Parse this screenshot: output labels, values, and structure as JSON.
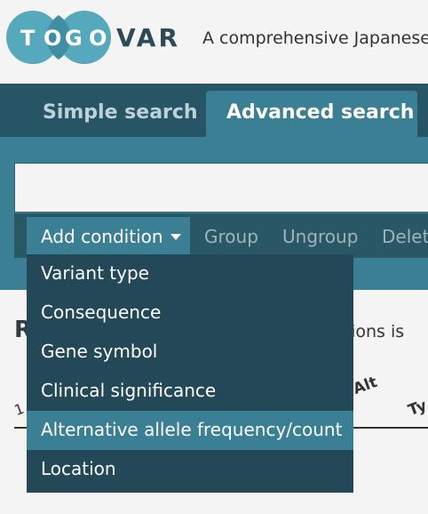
{
  "header": {
    "logo_letters": [
      "T",
      "O",
      "G",
      "O"
    ],
    "logo_suffix": "VAR",
    "tagline": "A comprehensive Japanese"
  },
  "nav": {
    "tabs": [
      {
        "label": "Simple search",
        "active": false
      },
      {
        "label": "Advanced search",
        "active": true
      }
    ]
  },
  "search": {
    "value": ""
  },
  "toolbar": {
    "add_condition": "Add condition",
    "group": "Group",
    "ungroup": "Ungroup",
    "delete": "Delete"
  },
  "dropdown": {
    "items": [
      "Variant type",
      "Consequence",
      "Gene symbol",
      "Clinical significance",
      "Alternative allele frequency/count",
      "Location"
    ],
    "highlighted_index": 4
  },
  "results": {
    "heading_fragment": "R",
    "text_fragment": "ations is",
    "columns_visible": [
      "Alt",
      "Ty"
    ]
  },
  "colors": {
    "nav_bg": "#275566",
    "accent": "#3b7f94",
    "dropdown_bg": "#234958",
    "logo_teal": "#4aa3b8"
  }
}
